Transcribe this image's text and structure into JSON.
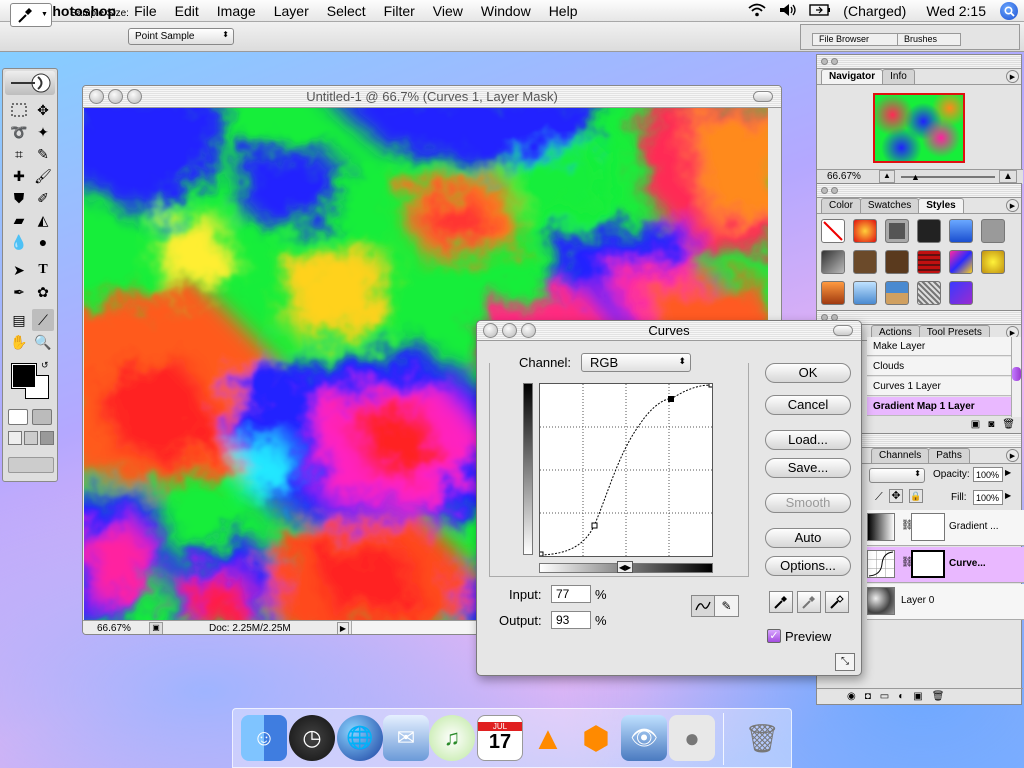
{
  "menubar": {
    "app": "Photoshop",
    "items": [
      "File",
      "Edit",
      "Image",
      "Layer",
      "Select",
      "Filter",
      "View",
      "Window",
      "Help"
    ],
    "battery": "(Charged)",
    "clock": "Wed 2:15"
  },
  "options_bar": {
    "sample_size_label": "Sample Size:",
    "sample_size_value": "Point Sample",
    "file_browser_tab": "File Browser",
    "brushes_tab": "Brushes"
  },
  "document": {
    "title": "Untitled-1 @ 66.7% (Curves 1, Layer Mask)",
    "zoom": "66.67%",
    "doc_info": "Doc: 2.25M/2.25M"
  },
  "navigator": {
    "tabs": [
      "Navigator",
      "Info"
    ],
    "zoom": "66.67%"
  },
  "color_palette": {
    "tabs": [
      "Color",
      "Swatches",
      "Styles"
    ],
    "active_tab": "Styles"
  },
  "history": {
    "tabs": [
      "Actions",
      "Tool Presets"
    ],
    "items": [
      "Make Layer",
      "Clouds",
      "Curves 1 Layer",
      "Gradient Map 1 Layer"
    ]
  },
  "layers": {
    "tabs": [
      "Channels",
      "Paths"
    ],
    "opacity_label": "Opacity:",
    "opacity_value": "100%",
    "fill_label": "Fill:",
    "fill_value": "100%",
    "rows": [
      "Gradient ...",
      "Curve...",
      "Layer 0"
    ]
  },
  "curves": {
    "title": "Curves",
    "channel_label": "Channel:",
    "channel_value": "RGB",
    "buttons": {
      "ok": "OK",
      "cancel": "Cancel",
      "load": "Load...",
      "save": "Save...",
      "smooth": "Smooth",
      "auto": "Auto",
      "options": "Options..."
    },
    "input_label": "Input:",
    "input_value": "77",
    "output_label": "Output:",
    "output_value": "93",
    "percent": "%",
    "preview_label": "Preview",
    "preview_checked": true
  },
  "dock": {
    "items": [
      "finder-icon",
      "dashboard-icon",
      "globe-icon",
      "mail-icon",
      "itunes-icon",
      "ical-icon",
      "vlc-icon",
      "reason-icon",
      "photoshop-icon",
      "apple-icon",
      "trash-icon"
    ],
    "ical_day": "17",
    "ical_month": "JUL"
  }
}
